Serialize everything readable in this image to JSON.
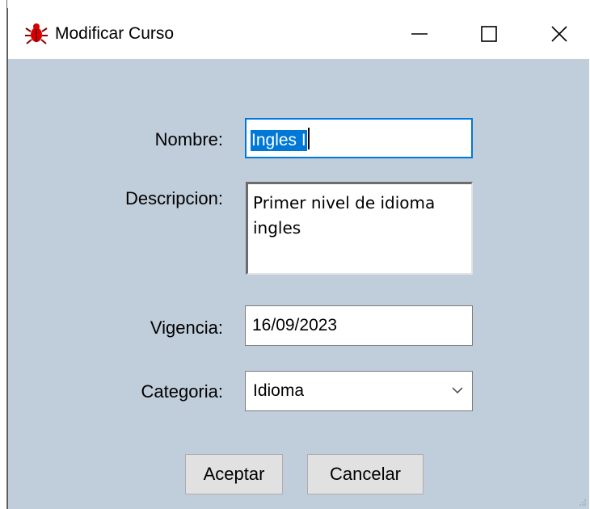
{
  "window": {
    "title": "Modificar Curso",
    "icon": "bug-icon",
    "controls": {
      "minimize": "minimize-icon",
      "maximize": "maximize-icon",
      "close": "close-icon"
    }
  },
  "form": {
    "nombre": {
      "label": "Nombre:",
      "value": "Ingles I"
    },
    "descripcion": {
      "label": "Descripcion:",
      "value": "Primer nivel de idioma\ningles"
    },
    "vigencia": {
      "label": "Vigencia:",
      "value": "16/09/2023"
    },
    "categoria": {
      "label": "Categoria:",
      "selected": "Idioma"
    }
  },
  "buttons": {
    "aceptar": "Aceptar",
    "cancelar": "Cancelar"
  },
  "colors": {
    "client_bg": "#c0cddb",
    "focus_accent": "#0078d7",
    "button_bg": "#e1e1e1"
  }
}
